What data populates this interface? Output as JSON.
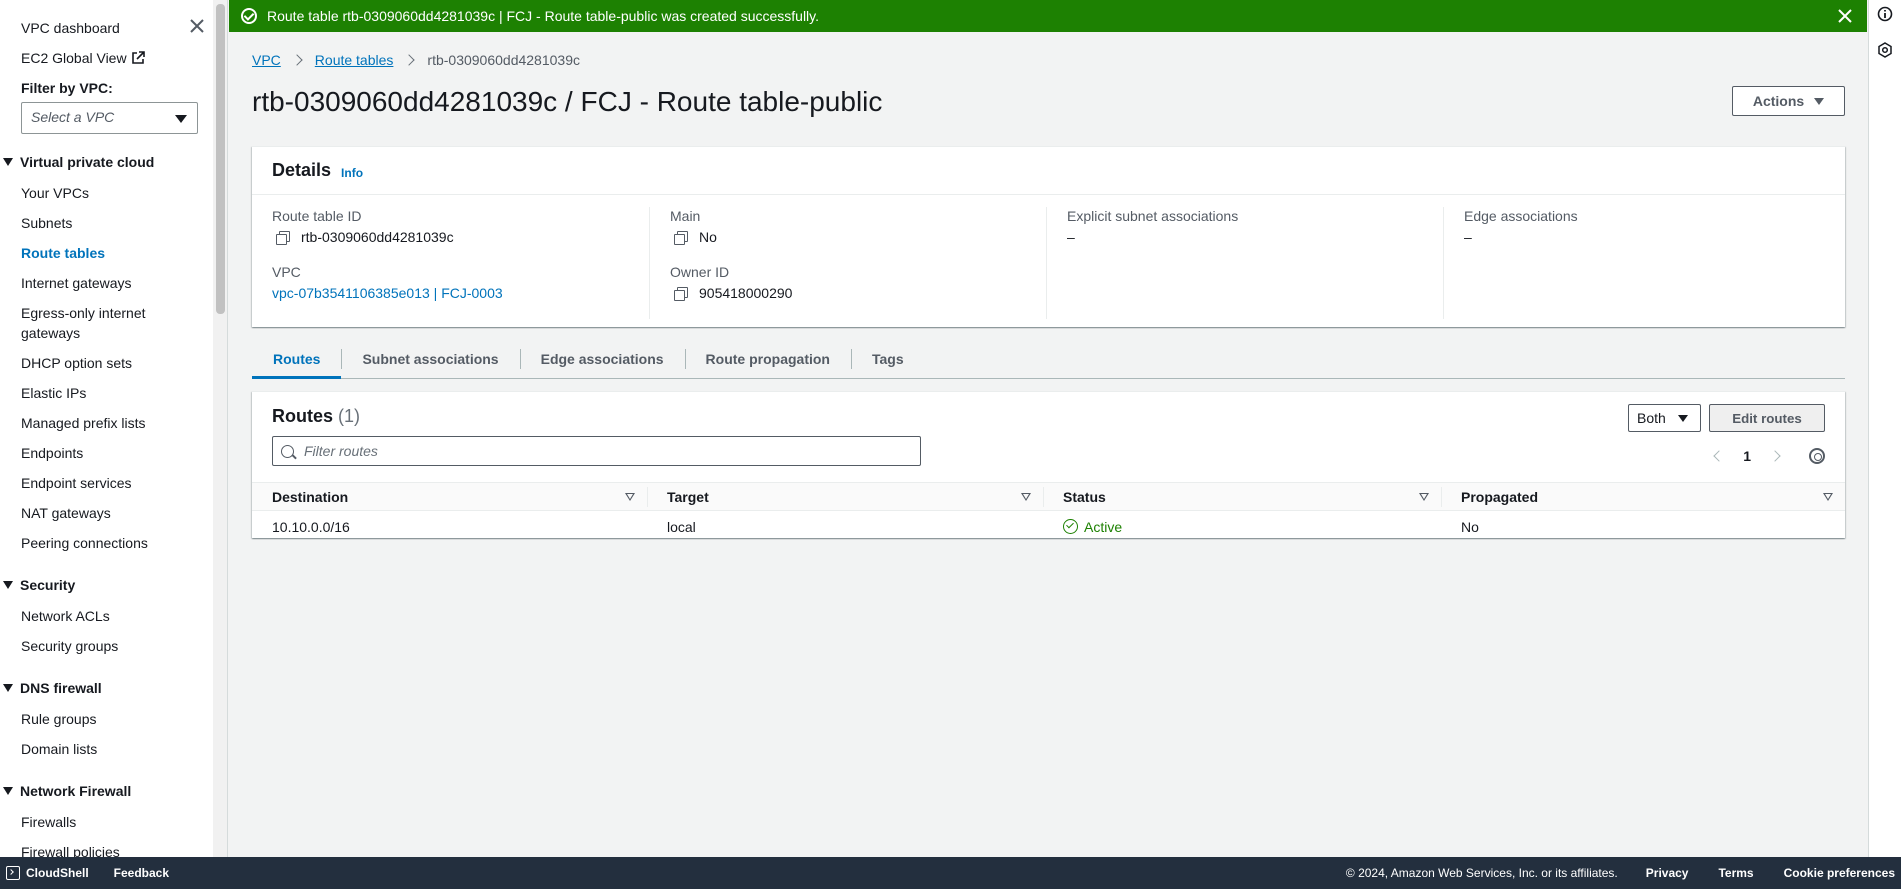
{
  "sidebar": {
    "top_links": [
      "VPC dashboard",
      "EC2 Global View"
    ],
    "filter_label": "Filter by VPC:",
    "filter_placeholder": "Select a VPC",
    "sections": [
      {
        "title": "Virtual private cloud",
        "items": [
          "Your VPCs",
          "Subnets",
          "Route tables",
          "Internet gateways",
          "Egress-only internet gateways",
          "DHCP option sets",
          "Elastic IPs",
          "Managed prefix lists",
          "Endpoints",
          "Endpoint services",
          "NAT gateways",
          "Peering connections"
        ],
        "active": "Route tables"
      },
      {
        "title": "Security",
        "items": [
          "Network ACLs",
          "Security groups"
        ]
      },
      {
        "title": "DNS firewall",
        "items": [
          "Rule groups",
          "Domain lists"
        ]
      },
      {
        "title": "Network Firewall",
        "items": [
          "Firewalls",
          "Firewall policies"
        ]
      }
    ]
  },
  "banner": {
    "message": "Route table rtb-0309060dd4281039c | FCJ - Route table-public was created successfully."
  },
  "breadcrumb": {
    "items": [
      "VPC",
      "Route tables"
    ],
    "current": "rtb-0309060dd4281039c"
  },
  "page": {
    "title": "rtb-0309060dd4281039c / FCJ - Route table-public",
    "actions_label": "Actions"
  },
  "details": {
    "title": "Details",
    "info_label": "Info",
    "route_table_id_label": "Route table ID",
    "route_table_id": "rtb-0309060dd4281039c",
    "vpc_label": "VPC",
    "vpc_value": "vpc-07b3541106385e013 | FCJ-0003",
    "main_label": "Main",
    "main_value": "No",
    "owner_label": "Owner ID",
    "owner_value": "905418000290",
    "explicit_label": "Explicit subnet associations",
    "explicit_value": "–",
    "edge_label": "Edge associations",
    "edge_value": "–"
  },
  "tabs": [
    "Routes",
    "Subnet associations",
    "Edge associations",
    "Route propagation",
    "Tags"
  ],
  "active_tab": "Routes",
  "routes": {
    "title": "Routes",
    "count": "(1)",
    "filter_placeholder": "Filter routes",
    "both_label": "Both",
    "edit_label": "Edit routes",
    "page_number": "1",
    "columns": [
      "Destination",
      "Target",
      "Status",
      "Propagated"
    ],
    "rows": [
      {
        "destination": "10.10.0.0/16",
        "target": "local",
        "status": "Active",
        "propagated": "No"
      }
    ]
  },
  "footer": {
    "cloudshell": "CloudShell",
    "feedback": "Feedback",
    "copyright": "© 2024, Amazon Web Services, Inc. or its affiliates.",
    "links": [
      "Privacy",
      "Terms",
      "Cookie preferences"
    ]
  },
  "colors": {
    "accent": "#0073bb",
    "success": "#1d8102",
    "footer_bg": "#232f3e"
  }
}
